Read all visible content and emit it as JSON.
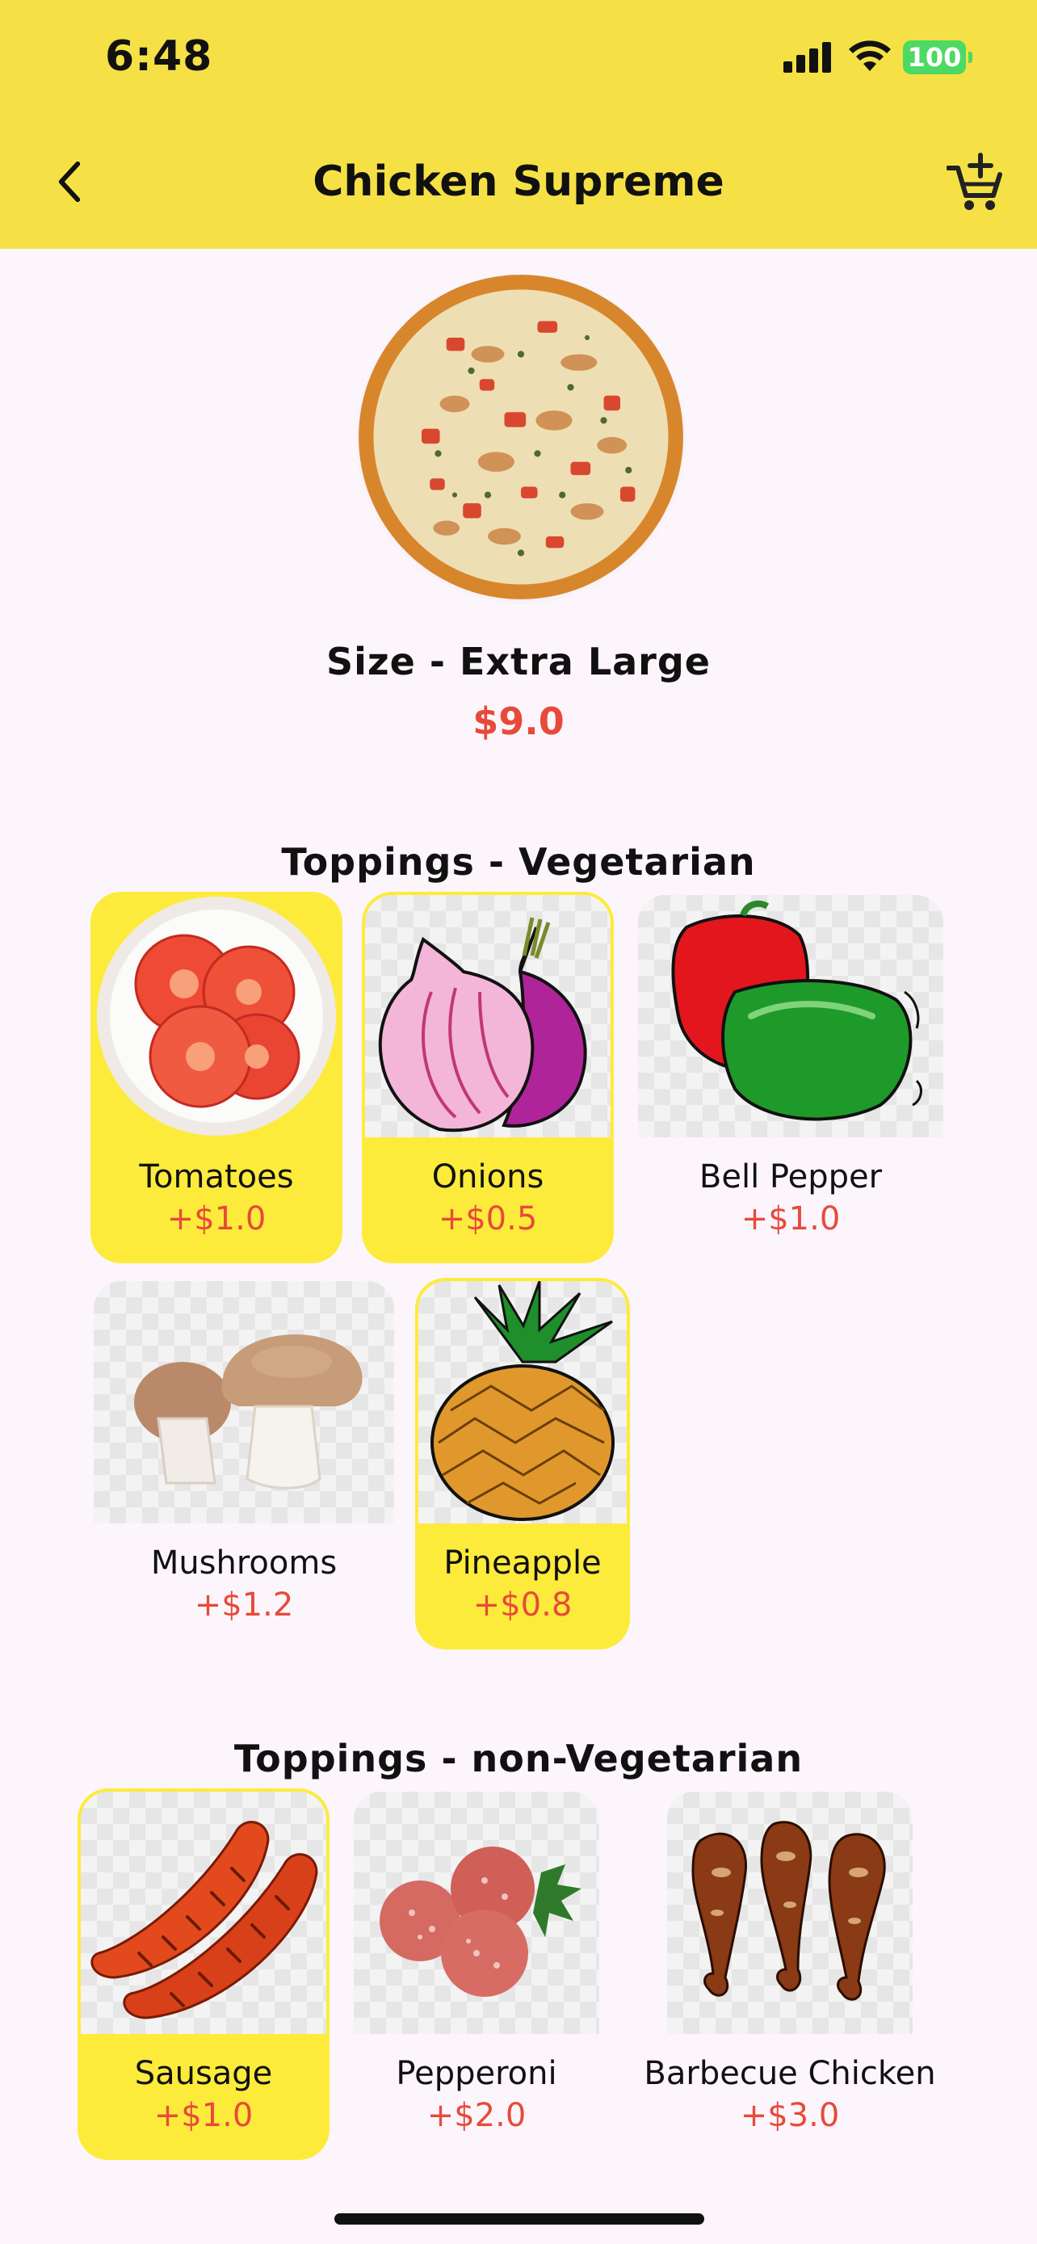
{
  "status_bar": {
    "time": "6:48",
    "battery": "100"
  },
  "header": {
    "title": "Chicken Supreme"
  },
  "product": {
    "size_label": "Size - Extra Large",
    "price": "$9.0"
  },
  "sections": [
    {
      "title": "Toppings - Vegetarian",
      "items": [
        {
          "name": "Tomatoes",
          "price": "+$1.0",
          "selected": true,
          "icon": "tomato-icon"
        },
        {
          "name": "Onions",
          "price": "+$0.5",
          "selected": true,
          "icon": "onion-icon"
        },
        {
          "name": "Bell Pepper",
          "price": "+$1.0",
          "selected": false,
          "icon": "bell-pepper-icon"
        },
        {
          "name": "Mushrooms",
          "price": "+$1.2",
          "selected": false,
          "icon": "mushroom-icon"
        },
        {
          "name": "Pineapple",
          "price": "+$0.8",
          "selected": true,
          "icon": "pineapple-icon"
        }
      ]
    },
    {
      "title": "Toppings - non-Vegetarian",
      "items": [
        {
          "name": "Sausage",
          "price": "+$1.0",
          "selected": true,
          "icon": "sausage-icon"
        },
        {
          "name": "Pepperoni",
          "price": "+$2.0",
          "selected": false,
          "icon": "pepperoni-icon"
        },
        {
          "name": "Barbecue Chicken",
          "price": "+$3.0",
          "selected": false,
          "icon": "bbq-chicken-icon"
        }
      ]
    }
  ],
  "colors": {
    "header_bg": "#f5e146",
    "selected_card": "#fdeb3c",
    "price_red": "#e84a3a",
    "page_bg": "#fcf6fc"
  }
}
